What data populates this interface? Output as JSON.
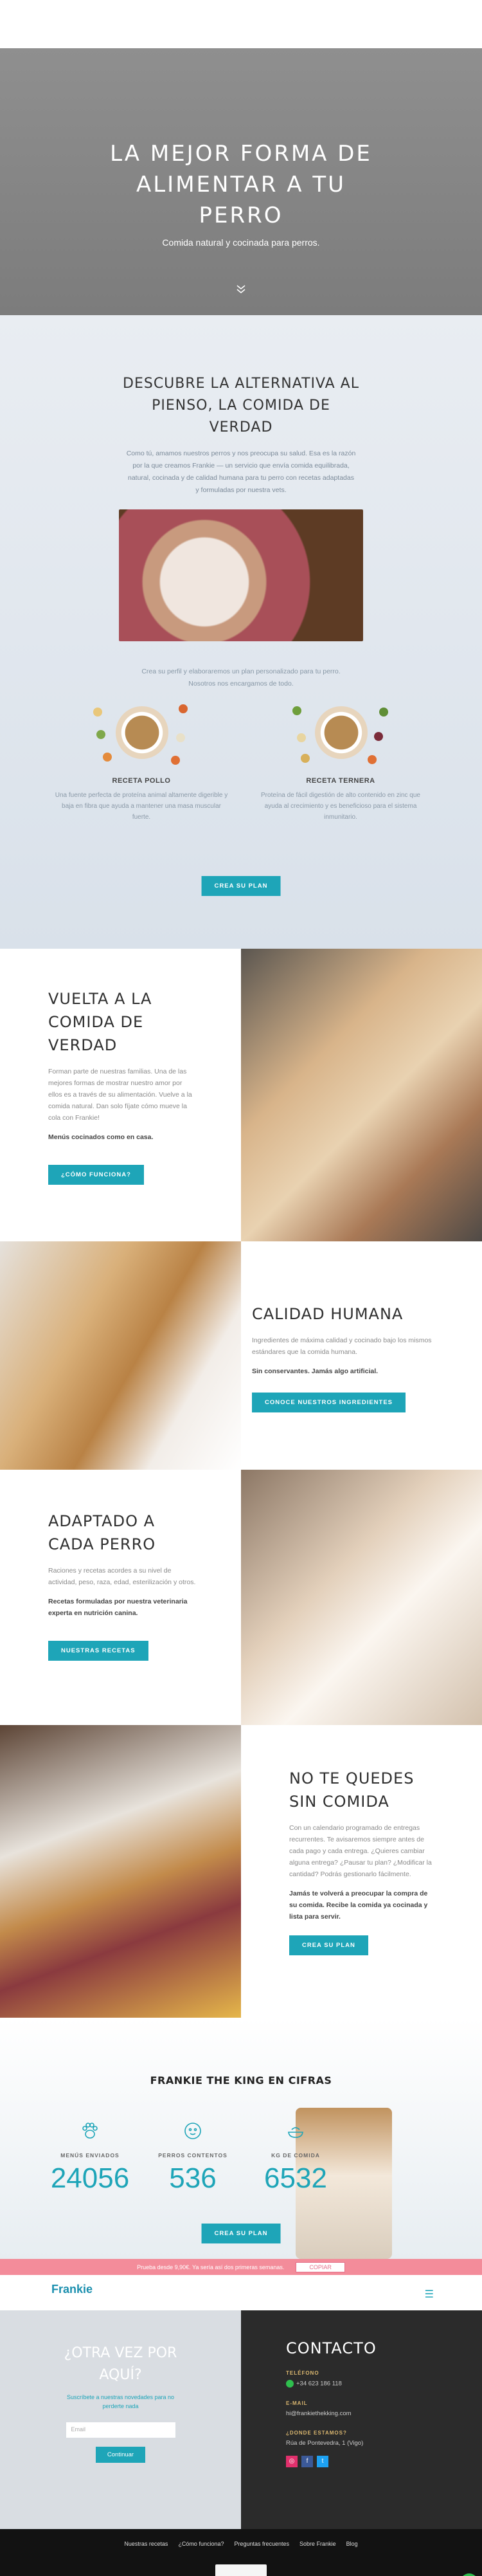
{
  "hero": {
    "title": "LA MEJOR FORMA DE ALIMENTAR A TU PERRO",
    "subtitle": "Comida natural y cocinada para perros."
  },
  "discover": {
    "title": "DESCUBRE LA ALTERNATIVA AL PIENSO, LA COMIDA DE VERDAD",
    "lead": "Como tú, amamos nuestros perros y nos preocupa su salud. Esa es la razón por la que creamos Frankie — un servicio que envía comida equilibrada, natural, cocinada y de calidad humana para tu perro con recetas adaptadas y formuladas por nuestra vets.",
    "sub": "Crea su perfil y elaboraremos un plan personalizado para tu perro. Nosotros nos encargamos de todo.",
    "recipes": [
      {
        "name": "RECETA POLLO",
        "desc": "Una fuente perfecta de proteína animal altamente digerible y baja en fibra que ayuda a mantener una masa muscular fuerte."
      },
      {
        "name": "RECETA TERNERA",
        "desc": "Proteína de fácil digestión de alto contenido en zinc que ayuda al crecimiento y es beneficioso para el sistema inmunitario."
      }
    ],
    "cta": "CREA SU PLAN"
  },
  "sections": {
    "vuelta": {
      "title": "VUELTA A LA COMIDA DE VERDAD",
      "desc": "Forman parte de nuestras familias. Una de las mejores formas de mostrar nuestro amor por ellos es a través de su alimentación. Vuelve a la comida natural. Dan solo fíjate cómo mueve la cola con Frankie!",
      "strong": "Menús cocinados como en casa.",
      "cta": "¿CÓMO FUNCIONA?"
    },
    "calidad": {
      "title": "CALIDAD HUMANA",
      "desc": "Ingredientes de máxima calidad y cocinado bajo los mismos estándares que la comida humana.",
      "strong": "Sin conservantes. Jamás algo artificial.",
      "cta": "CONOCE NUESTROS INGREDIENTES"
    },
    "adaptado": {
      "title": "ADAPTADO A CADA PERRO",
      "desc": "Raciones y recetas acordes a su nivel de actividad, peso, raza, edad, esterilización y otros.",
      "strong": "Recetas formuladas por nuestra veterinaria experta en nutrición canina.",
      "cta": "NUESTRAS RECETAS"
    },
    "nocomida": {
      "title": "NO TE QUEDES SIN COMIDA",
      "desc": "Con un calendario programado de entregas recurrentes. Te avisaremos siempre antes de cada pago y cada entrega. ¿Quieres cambiar alguna entrega? ¿Pausar tu plan? ¿Modificar la cantidad? Podrás gestionarlo fácilmente.",
      "strong": "Jamás te volverá a preocupar la compra de su comida. Recibe la comida ya cocinada y lista para servir.",
      "cta": "CREA SU PLAN"
    }
  },
  "stats": {
    "title": "FRANKIE THE KING EN CIFRAS",
    "items": [
      {
        "label": "MENÚS ENVIADOS",
        "value": "24056",
        "icon": "paw-icon"
      },
      {
        "label": "PERROS CONTENTOS",
        "value": "536",
        "icon": "dog-face-icon"
      },
      {
        "label": "KG DE COMIDA",
        "value": "6532",
        "icon": "food-icon"
      }
    ],
    "cta": "CREA SU PLAN"
  },
  "promo": {
    "text": "Prueba desde 9,90€. Ya sería así dos primeras semanas.",
    "code": "COPIAR"
  },
  "nav": {
    "logo": "Frankie"
  },
  "footer": {
    "left_title": "¿OTRA VEZ POR AQUÍ?",
    "left_text": "Suscríbete a nuestras novedades para no perderte nada",
    "email_placeholder": "Email",
    "continue": "Continuar",
    "contact_title": "CONTACTO",
    "phone_label": "TELÉFONO",
    "phone": "+34 623 186 118",
    "email_label": "E-MAIL",
    "email": "hi@frankiethekking.com",
    "where_label": "¿DONDE ESTAMOS?",
    "address": "Rúa de Pontevedra, 1 (Vigo)",
    "links": [
      "Nuestras recetas",
      "¿Cómo funciona?",
      "Preguntas frecuentes",
      "Sobre Frankie",
      "Blog"
    ]
  }
}
